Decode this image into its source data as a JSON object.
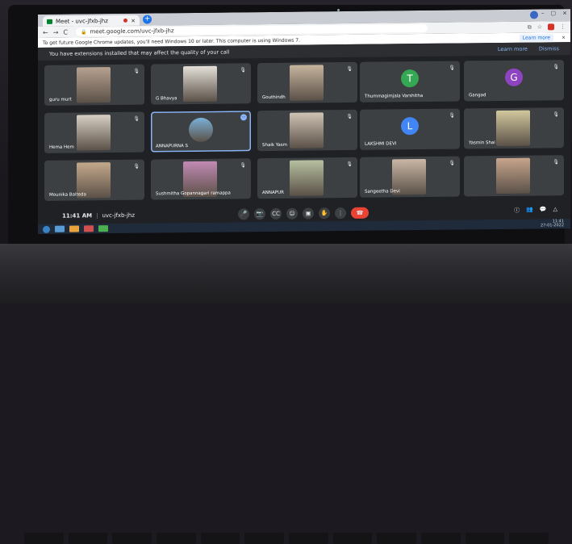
{
  "browser": {
    "tab_title": "Meet - uvc-jfxb-jhz",
    "tab_close": "×",
    "new_tab": "+",
    "window_controls": [
      "–",
      "▢",
      "×"
    ],
    "back": "←",
    "forward": "→",
    "reload": "C",
    "url": "meet.google.com/uvc-jfxb-jhz",
    "toolbar_icons": [
      "⧉",
      "☆",
      "⋮"
    ]
  },
  "infobar": {
    "message": "To get future Google Chrome updates, you'll need Windows 10 or later. This computer is using Windows 7.",
    "learn_more": "Learn more",
    "close": "×"
  },
  "meet_banner": {
    "message": "You have extensions installed that may affect the quality of your call",
    "learn_more": "Learn more",
    "dismiss": "Dismiss"
  },
  "participants": [
    {
      "name": "guru murt",
      "kind": "photo",
      "tone": "#b7a190"
    },
    {
      "name": "G Bhavya",
      "kind": "photo",
      "tone": "#e4e0d8"
    },
    {
      "name": "Gouthindh",
      "kind": "photo",
      "tone": "#c6b49d"
    },
    {
      "name": "Thummagimjala Varshitha",
      "kind": "avatar",
      "letter": "T",
      "color": "#34a853"
    },
    {
      "name": "Gangad",
      "kind": "avatar",
      "letter": "G",
      "color": "#8e44c0"
    },
    {
      "name": "Hema Hem",
      "kind": "photo",
      "tone": "#d8cfc4"
    },
    {
      "name": "ANNAPURNA S",
      "kind": "photo",
      "tone": "#7ab0d8",
      "active": true
    },
    {
      "name": "Shaik Yasm",
      "kind": "photo",
      "tone": "#cfc3b4"
    },
    {
      "name": "LAKSHMI DEVI",
      "kind": "avatar",
      "letter": "L",
      "color": "#4285f4"
    },
    {
      "name": "Yasmin Shai",
      "kind": "photo",
      "tone": "#d2c89d"
    },
    {
      "name": "Mounika Balteda",
      "kind": "photo",
      "tone": "#c4a98b"
    },
    {
      "name": "Sushmitha Gopannagari ramappa",
      "kind": "photo",
      "tone": "#c28ab4"
    },
    {
      "name": "ANNAPUR",
      "kind": "photo",
      "tone": "#b6c0a0"
    },
    {
      "name": "Sangeetha Devi",
      "kind": "photo",
      "tone": "#c9b7a6"
    },
    {
      "name": "",
      "kind": "photo",
      "tone": "#c7a58c"
    }
  ],
  "controls": {
    "time": "11:41 AM",
    "separator": "|",
    "meeting_code": "uvc-jfxb-jhz",
    "buttons": [
      "🎤",
      "📷",
      "CC",
      "☺",
      "▣",
      "✋",
      "⋮"
    ],
    "end_call": "☎",
    "right": [
      "ⓘ",
      "👥",
      "💬",
      "△"
    ]
  },
  "taskbar": {
    "clock": "11:41",
    "date": "27-01-2022"
  }
}
